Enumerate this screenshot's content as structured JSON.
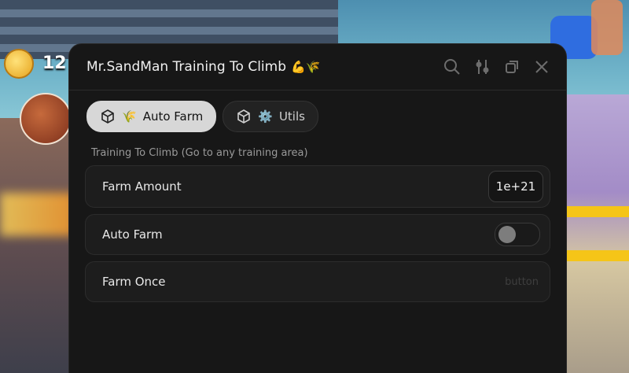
{
  "background": {
    "coin_count": "12"
  },
  "window": {
    "title": "Mr.SandMan Training To Climb",
    "title_emoji": "💪🌾",
    "actions": [
      "search-icon",
      "settings-slider-icon",
      "minimize-icon",
      "close-icon"
    ]
  },
  "tabs": [
    {
      "label": "Auto Farm",
      "emoji": "🌾",
      "active": true
    },
    {
      "label": "Utils",
      "emoji": "⚙️",
      "active": false
    }
  ],
  "section": {
    "label": "Training To Climb (Go to any training area)"
  },
  "rows": [
    {
      "label": "Farm Amount",
      "value": "1e+21",
      "type": "input"
    },
    {
      "label": "Auto Farm",
      "type": "toggle",
      "state": "off"
    },
    {
      "label": "Farm Once",
      "hint": "button",
      "type": "button"
    }
  ],
  "colors": {
    "window_bg": "#171717",
    "row_bg": "#1d1d1d",
    "tab_active_bg": "#d7d7d7"
  }
}
